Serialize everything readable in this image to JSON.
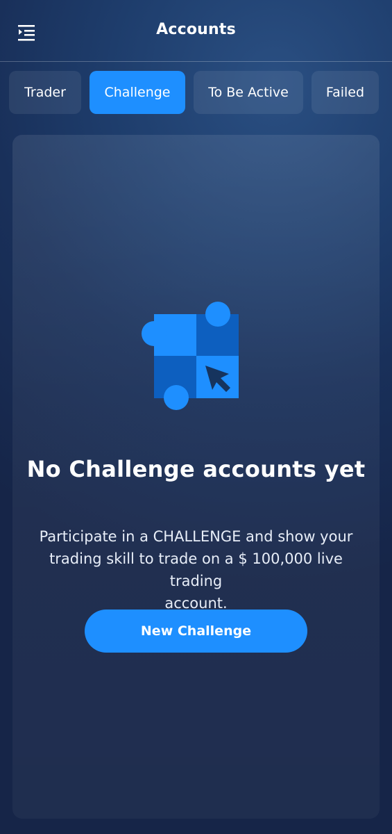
{
  "header": {
    "title": "Accounts",
    "menu_icon": "menu-indent-icon"
  },
  "tabs": [
    {
      "label": "Trader",
      "active": false
    },
    {
      "label": "Challenge",
      "active": true
    },
    {
      "label": "To Be Active",
      "active": false
    },
    {
      "label": "Failed",
      "active": false
    }
  ],
  "empty_state": {
    "icon": "challenge-grid-cursor-icon",
    "title": "No Challenge accounts yet",
    "description_lines": [
      "Participate in a CHALLENGE and show your",
      "trading skill to trade on a $ 100,000 live trading",
      "account."
    ],
    "button_label": "New Challenge"
  },
  "colors": {
    "accent": "#1e8fff",
    "background": "#1e3d6c",
    "tab_inactive": "#2a4a74",
    "icon_dark": "#0d5fbf"
  }
}
